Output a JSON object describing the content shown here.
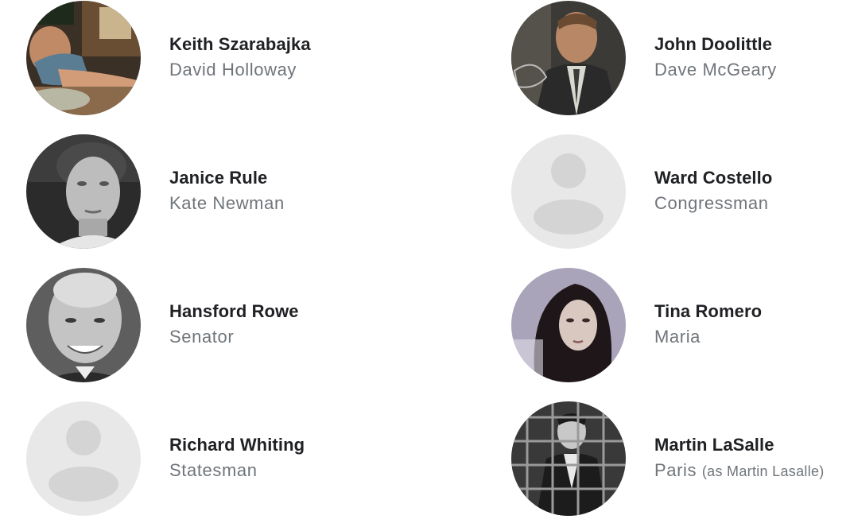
{
  "cast": {
    "left": [
      {
        "name": "Keith Szarabajka",
        "role": "David Holloway",
        "note": "",
        "photo": "photo"
      },
      {
        "name": "Janice Rule",
        "role": "Kate Newman",
        "note": "",
        "photo": "photo-bw"
      },
      {
        "name": "Hansford Rowe",
        "role": "Senator",
        "note": "",
        "photo": "photo-bw"
      },
      {
        "name": "Richard Whiting",
        "role": "Statesman",
        "note": "",
        "photo": "placeholder-person-icon"
      }
    ],
    "right": [
      {
        "name": "John Doolittle",
        "role": "Dave McGeary",
        "note": "",
        "photo": "photo"
      },
      {
        "name": "Ward Costello",
        "role": "Congressman",
        "note": "",
        "photo": "placeholder-person-icon"
      },
      {
        "name": "Tina Romero",
        "role": "Maria",
        "note": "",
        "photo": "photo"
      },
      {
        "name": "Martin LaSalle",
        "role": "Paris",
        "note": "(as Martin Lasalle)",
        "photo": "photo-bw"
      }
    ]
  },
  "colors": {
    "name_text": "#202124",
    "role_text": "#70757a",
    "placeholder_bg": "#e8e8e8",
    "placeholder_fg": "#d4d4d4"
  }
}
